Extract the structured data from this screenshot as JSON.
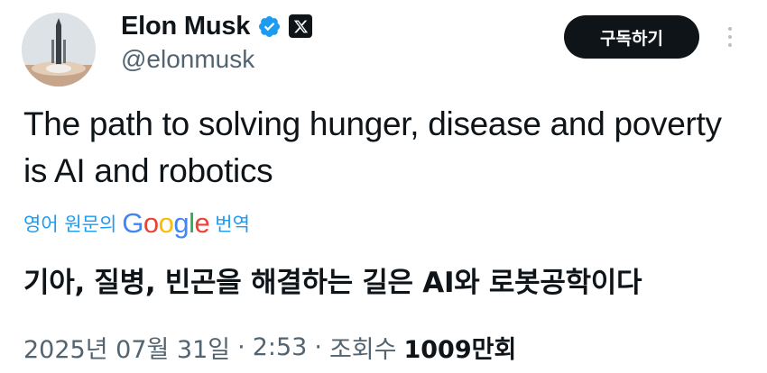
{
  "author": {
    "display_name": "Elon Musk",
    "handle": "@elonmusk",
    "verified": true,
    "badge_icon": "x-logo-icon",
    "avatar_icon": "rocket-launch-avatar"
  },
  "actions": {
    "subscribe_label": "구독하기",
    "more_icon": "more-vertical-icon"
  },
  "tweet": {
    "text": "The path to solving hunger, disease and poverty is AI and robotics"
  },
  "translation": {
    "prefix": "영어 원문의",
    "brand": "Google",
    "suffix": "번역",
    "text": "기아, 질병, 빈곤을 해결하는 길은 AI와 로봇공학이다"
  },
  "meta": {
    "date": "2025년 07월 31일",
    "separator": "·",
    "time": "2:53",
    "views_label": "조회수",
    "views_count": "1009만회"
  },
  "colors": {
    "text": "#0f1419",
    "secondary": "#536471",
    "link": "#1d9bf0",
    "verified": "#1d9bf0",
    "button_bg": "#0f1419"
  }
}
